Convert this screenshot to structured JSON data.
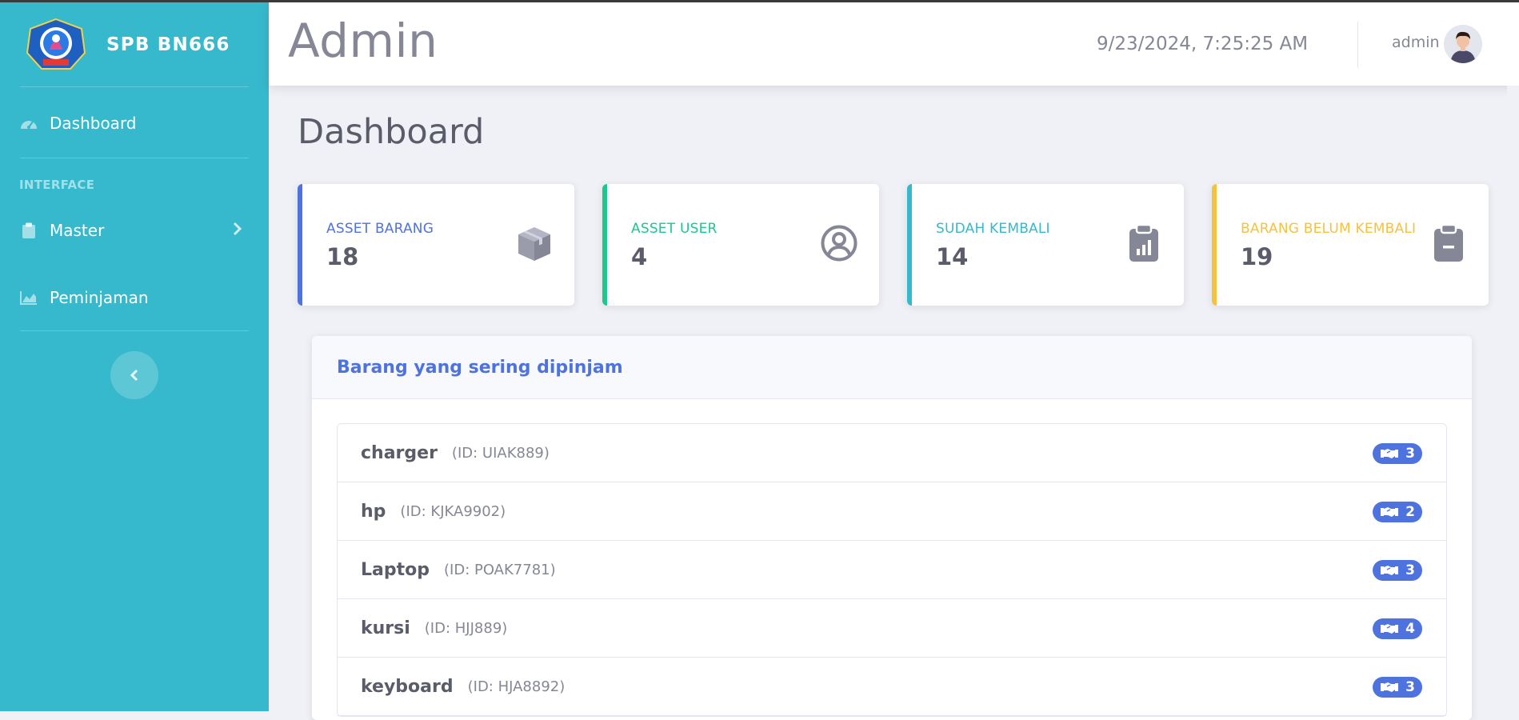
{
  "sidebar": {
    "brand": "SPB BN666",
    "items": [
      {
        "label": "Dashboard",
        "icon": "tachometer-icon"
      },
      {
        "label": "Master",
        "icon": "clipboard-icon"
      },
      {
        "label": "Peminjaman",
        "icon": "area-chart-icon"
      }
    ],
    "heading": "INTERFACE",
    "colors": {
      "background": "#36b9cc"
    }
  },
  "topbar": {
    "title": "Admin",
    "datetime": "9/23/2024, 7:25:25 AM",
    "user": "admin"
  },
  "page": {
    "title": "Dashboard"
  },
  "cards": [
    {
      "label": "ASSET BARANG",
      "value": "18",
      "color": "#4e73df",
      "icon": "box-icon"
    },
    {
      "label": "ASSET USER",
      "value": "4",
      "color": "#1cc88a",
      "icon": "user-circle-icon"
    },
    {
      "label": "SUDAH KEMBALI",
      "value": "14",
      "color": "#36b9cc",
      "icon": "clipboard-chart-icon"
    },
    {
      "label": "BARANG BELUM KEMBALI",
      "value": "19",
      "color": "#f6c23e",
      "icon": "clipboard-minus-icon"
    }
  ],
  "panel": {
    "title": "Barang yang sering dipinjam",
    "items": [
      {
        "name": "charger",
        "id": "(ID: UIAK889)",
        "count": "3"
      },
      {
        "name": "hp",
        "id": "(ID: KJKA9902)",
        "count": "2"
      },
      {
        "name": "Laptop",
        "id": "(ID: POAK7781)",
        "count": "3"
      },
      {
        "name": "kursi",
        "id": "(ID: HJJ889)",
        "count": "4"
      },
      {
        "name": "keyboard",
        "id": "(ID: HJA8892)",
        "count": "3"
      }
    ]
  }
}
